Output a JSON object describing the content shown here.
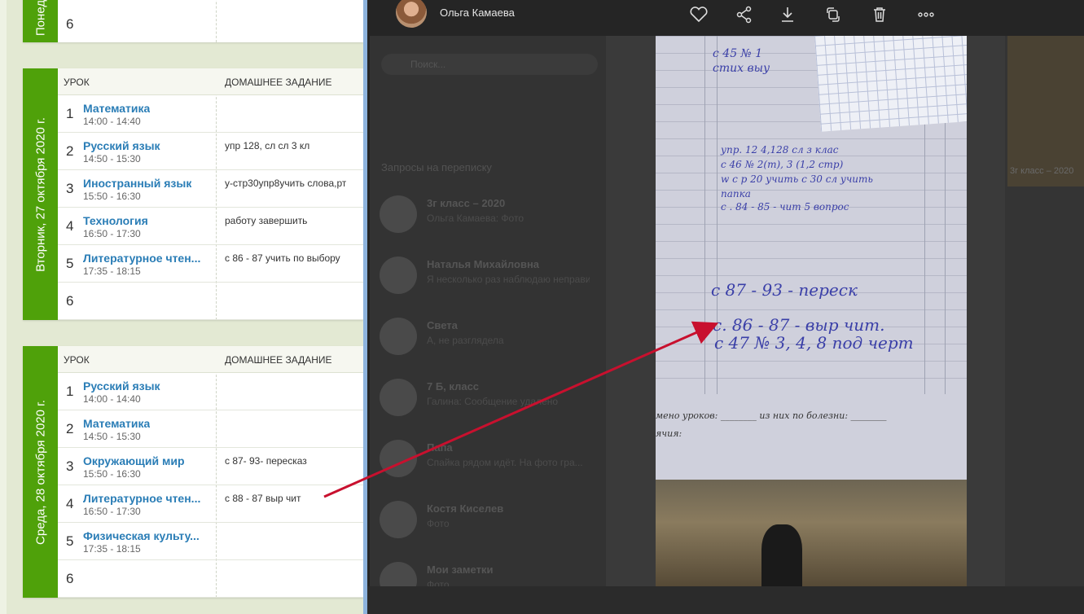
{
  "diary": {
    "day_top_label": "Понед",
    "day_top_last_row": "6",
    "col_lesson": "УРОК",
    "col_homework": "ДОМАШНЕЕ ЗАДАНИЕ",
    "tuesday": {
      "label": "Вторник, 27 октября 2020 г.",
      "rows": [
        {
          "num": "1",
          "subject": "Математика",
          "time": "14:00 - 14:40",
          "hw": ""
        },
        {
          "num": "2",
          "subject": "Русский язык",
          "time": "14:50 - 15:30",
          "hw": "упр 128, сл сл 3 кл"
        },
        {
          "num": "3",
          "subject": "Иностранный язык",
          "time": "15:50 - 16:30",
          "hw": "у-стр30упр8учить слова,рт"
        },
        {
          "num": "4",
          "subject": "Технология",
          "time": "16:50 - 17:30",
          "hw": "работу завершить"
        },
        {
          "num": "5",
          "subject": "Литературное чтен...",
          "time": "17:35 - 18:15",
          "hw": "с 86 - 87 учить по выбору"
        },
        {
          "num": "6",
          "subject": "",
          "time": "",
          "hw": ""
        }
      ]
    },
    "wednesday": {
      "label": "Среда, 28 октября 2020 г.",
      "rows": [
        {
          "num": "1",
          "subject": "Русский язык",
          "time": "14:00 - 14:40",
          "hw": ""
        },
        {
          "num": "2",
          "subject": "Математика",
          "time": "14:50 - 15:30",
          "hw": ""
        },
        {
          "num": "3",
          "subject": "Окружающий мир",
          "time": "15:50 - 16:30",
          "hw": "с 87- 93- пересказ"
        },
        {
          "num": "4",
          "subject": "Литературное чтен...",
          "time": "16:50 - 17:30",
          "hw": "с 88 - 87 выр чит"
        },
        {
          "num": "5",
          "subject": "Физическая культу...",
          "time": "17:35 - 18:15",
          "hw": ""
        },
        {
          "num": "6",
          "subject": "",
          "time": "",
          "hw": ""
        }
      ]
    }
  },
  "viewer": {
    "user_name": "Ольга Камаева",
    "icons": [
      "heart-icon",
      "share-icon",
      "download-icon",
      "rotate-icon",
      "trash-icon",
      "more-icon"
    ],
    "bg_search_placeholder": "Поиск...",
    "bg_requests": "Запросы на переписку",
    "bg_chats": [
      {
        "name": "3г класс – 2020",
        "text": "Ольга Камаева: Фото"
      },
      {
        "name": "Наталья Михайловна",
        "text": "Я несколько раз наблюдаю неправильно..."
      },
      {
        "name": "Света",
        "text": "А, не разглядела"
      },
      {
        "name": "7 Б, класс",
        "text": "Галина: Сообщение удалено"
      },
      {
        "name": "Папа",
        "text": "Спайка рядом идёт. На фото гра..."
      },
      {
        "name": "Костя Киселев",
        "text": "Фото"
      },
      {
        "name": "Мои заметки",
        "text": "Фото"
      }
    ],
    "bg_side_label": "3г класс – 2020",
    "photo_text": {
      "line1": "с 87 - 93 - переск",
      "line2": "с. 86 - 87 - выр чит.",
      "line3": "с 47 № 3, 4, 8 под черт",
      "upper1": "упр. 12 4,128 сл з клас",
      "upper2": "с 46 № 2(m), 3 (1,2 стр)",
      "upper3": "w с р 20 учить с 30 сл учить",
      "upper4": "папка",
      "upper5": "с . 84 - 85 - чит 5 вопрос",
      "top1": "с 45 № 1",
      "top2": "стих выу",
      "footer1": "мено уроков: ________ из них по болезни: ________",
      "footer2": "ячия:"
    },
    "accent": "#c8102e"
  }
}
